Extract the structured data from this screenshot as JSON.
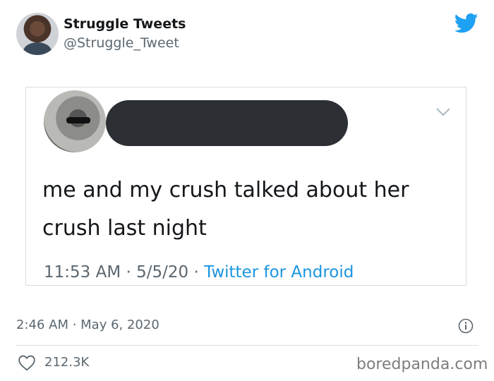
{
  "tweet": {
    "author_name": "Struggle Tweets",
    "author_handle": "@Struggle_Tweet",
    "timestamp": "2:46 AM · May 6, 2020",
    "likes": "212.3K"
  },
  "quoted": {
    "text_line1": "me and my crush talked about her",
    "text_line2": "crush last night",
    "time": "11:53 AM",
    "date": "5/5/20",
    "sep": " · ",
    "source": "Twitter for Android"
  },
  "watermark": "boredpanda.com",
  "colors": {
    "twitter_blue": "#1da1f2",
    "link_blue": "#1b95e0",
    "redaction": "#2c2f33",
    "text_secondary": "#5b6770"
  },
  "icons": {
    "brand": "twitter-bird-icon",
    "menu": "chevron-down-icon",
    "info": "info-icon",
    "like": "heart-icon"
  }
}
